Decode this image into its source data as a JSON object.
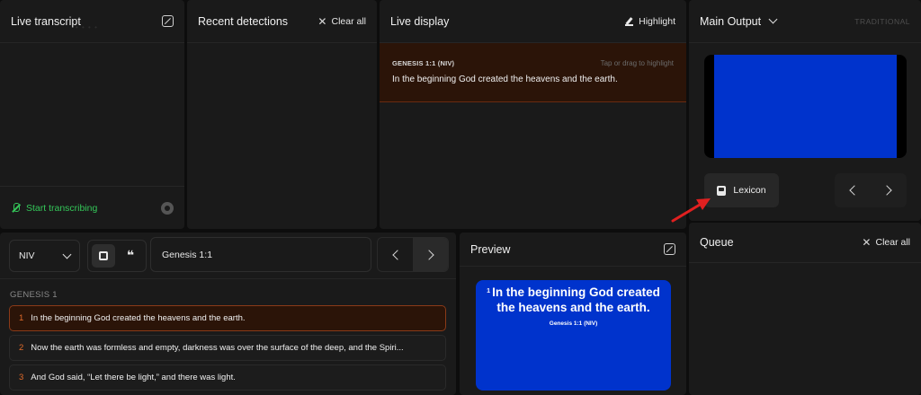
{
  "transcript": {
    "title": "Live transcript",
    "start_label": "Start transcribing"
  },
  "detections": {
    "title": "Recent detections",
    "clear_label": "Clear all"
  },
  "live_display": {
    "title": "Live display",
    "highlight_label": "Highlight",
    "reference": "GENESIS 1:1 (NIV)",
    "hint": "Tap or drag to highlight",
    "verse_text": "In the beginning God created the heavens and the earth."
  },
  "main_output": {
    "title": "Main Output",
    "mode_label": "TRADITIONAL",
    "lexicon_label": "Lexicon"
  },
  "bible": {
    "version": "NIV",
    "reference": "Genesis 1:1",
    "book_heading": "GENESIS 1",
    "verses": [
      {
        "num": "1",
        "text": "In the beginning God created the heavens and the earth."
      },
      {
        "num": "2",
        "text": "Now the earth was formless and empty, darkness was over the surface of the deep, and the Spiri..."
      },
      {
        "num": "3",
        "text": "And God said, “Let there be light,” and there was light."
      }
    ]
  },
  "preview": {
    "title": "Preview",
    "verse_num": "1",
    "text": "In the beginning God created the heavens and the earth.",
    "reference": "Genesis 1:1 (NIV)"
  },
  "queue": {
    "title": "Queue",
    "clear_label": "Clear all"
  },
  "colors": {
    "accent_orange": "#e06a2a",
    "live_green": "#34c759",
    "output_blue": "#0033cc",
    "annotation_red": "#e02020"
  }
}
